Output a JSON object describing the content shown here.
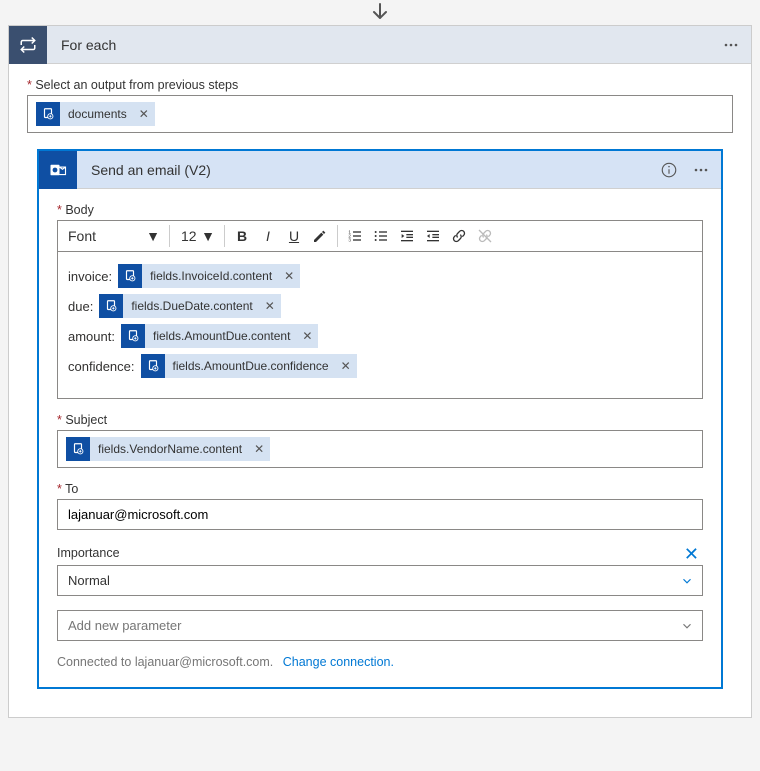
{
  "foreach": {
    "title": "For each",
    "select_label": "Select an output from previous steps",
    "token": "documents"
  },
  "email": {
    "title": "Send an email (V2)",
    "body": {
      "label": "Body",
      "font_label": "Font",
      "font_size": "12",
      "rows": [
        {
          "label": "invoice:",
          "token": "fields.InvoiceId.content"
        },
        {
          "label": "due:",
          "token": "fields.DueDate.content"
        },
        {
          "label": "amount:",
          "token": "fields.AmountDue.content"
        },
        {
          "label": "confidence:",
          "token": "fields.AmountDue.confidence"
        }
      ]
    },
    "subject": {
      "label": "Subject",
      "token": "fields.VendorName.content"
    },
    "to": {
      "label": "To",
      "value": "lajanuar@microsoft.com"
    },
    "importance": {
      "label": "Importance",
      "value": "Normal"
    },
    "add_param": "Add new parameter",
    "footer_connected": "Connected to lajanuar@microsoft.com.",
    "footer_change": "Change connection."
  }
}
